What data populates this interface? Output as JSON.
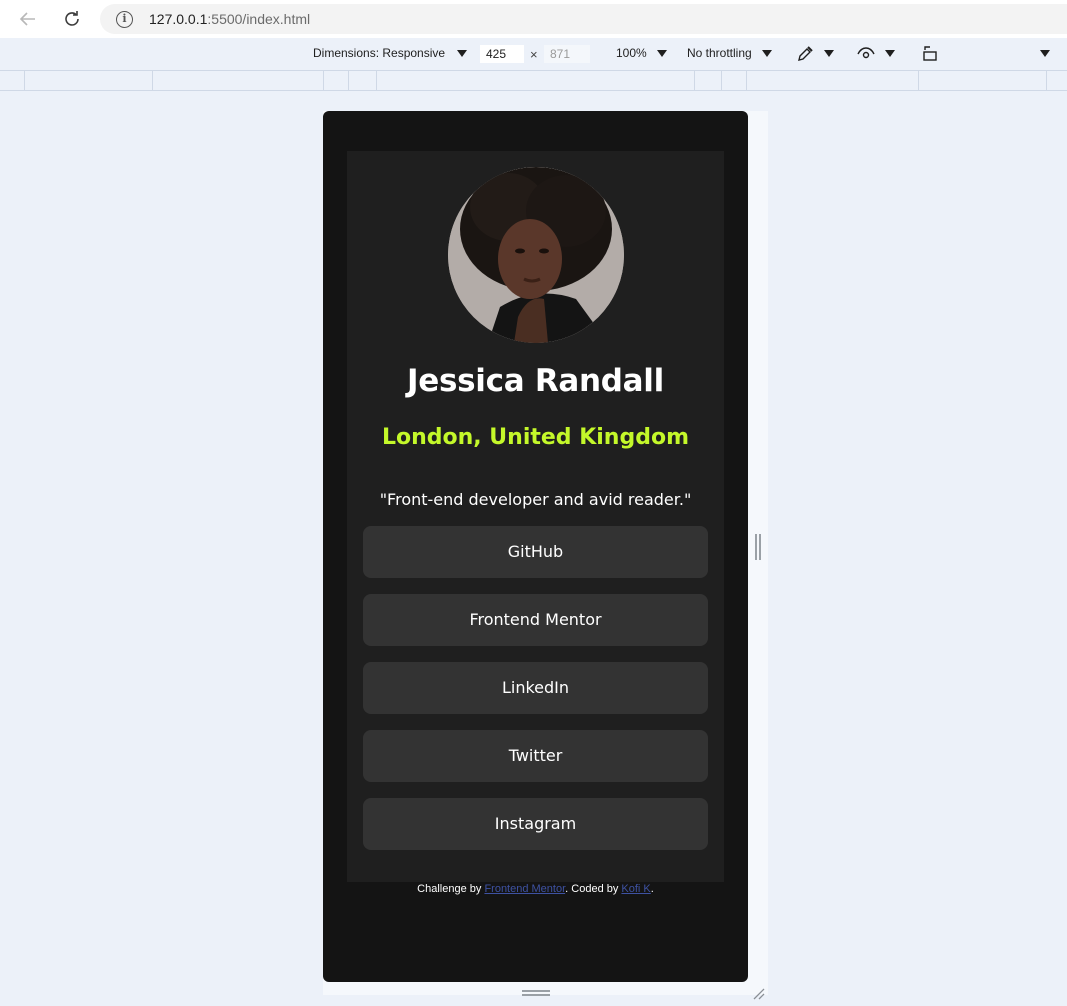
{
  "browser": {
    "url_host": "127.0.0.1",
    "url_rest": ":5500/index.html"
  },
  "devtools": {
    "dimensions_label": "Dimensions: Responsive",
    "width": "425",
    "times": "×",
    "height_placeholder": "871",
    "zoom": "100%",
    "throttling": "No throttling"
  },
  "profile": {
    "name": "Jessica Randall",
    "location": "London, United Kingdom",
    "bio": "\"Front-end developer and avid reader.\"",
    "links": [
      "GitHub",
      "Frontend Mentor",
      "LinkedIn",
      "Twitter",
      "Instagram"
    ],
    "accent_color": "#c4f82a"
  },
  "attribution": {
    "prefix": "Challenge by ",
    "challenge_link": "Frontend Mentor",
    "middle": ". Coded by ",
    "author_link": "Kofi K",
    "suffix": "."
  },
  "icons": {
    "back": "arrow-left-icon",
    "reload": "reload-icon",
    "info": "info-icon",
    "picker": "eyedropper-icon",
    "vision": "eye-icon",
    "rotate": "rotate-device-icon"
  }
}
